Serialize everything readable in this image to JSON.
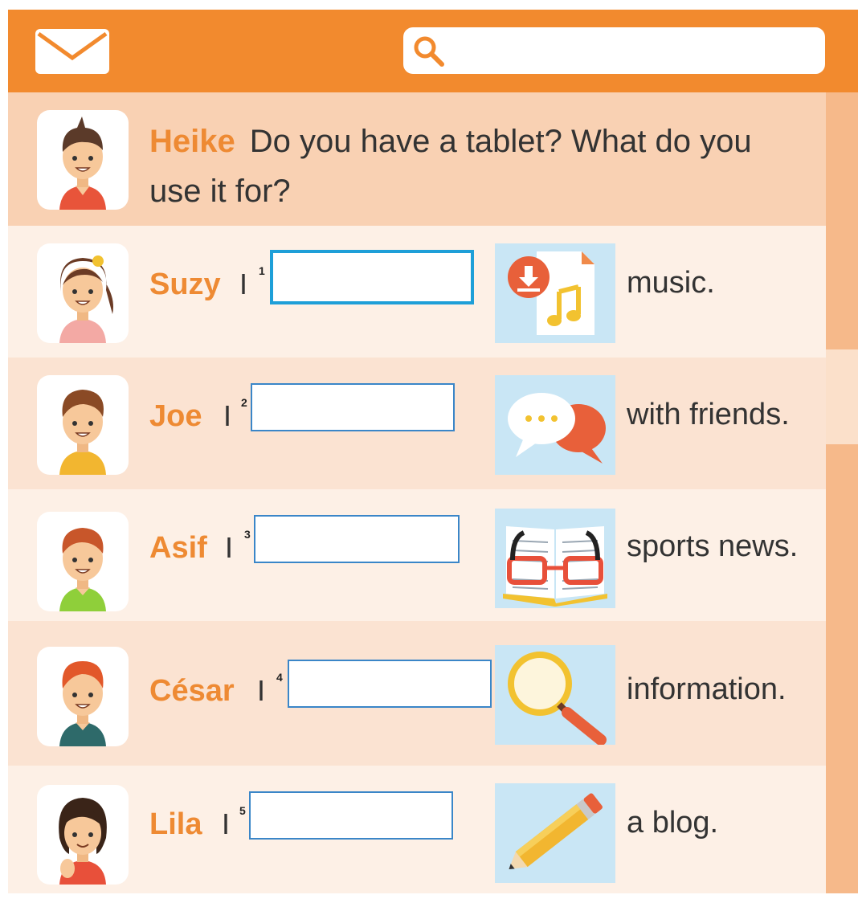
{
  "search": {
    "placeholder": ""
  },
  "question": {
    "name": "Heike",
    "text": "Do you have a tablet? What do you use it for?"
  },
  "answers": [
    {
      "name": "Suzy",
      "pronoun": "I",
      "number": "1",
      "value": "",
      "picture": "music-download-icon",
      "tail": "music."
    },
    {
      "name": "Joe",
      "pronoun": "I",
      "number": "2",
      "value": "",
      "picture": "chat-bubbles-icon",
      "tail": "with friends."
    },
    {
      "name": "Asif",
      "pronoun": "I",
      "number": "3",
      "value": "",
      "picture": "book-glasses-icon",
      "tail": "sports news."
    },
    {
      "name": "César",
      "pronoun": "I",
      "number": "4",
      "value": "",
      "picture": "magnifier-icon",
      "tail": "information."
    },
    {
      "name": "Lila",
      "pronoun": "I",
      "number": "5",
      "value": "",
      "picture": "pencil-icon",
      "tail": "a blog."
    }
  ],
  "colors": {
    "accent": "#f28a2e",
    "name": "#ee8a33",
    "field_border": "#3a86c8",
    "picture_bg": "#c9e6f5"
  }
}
